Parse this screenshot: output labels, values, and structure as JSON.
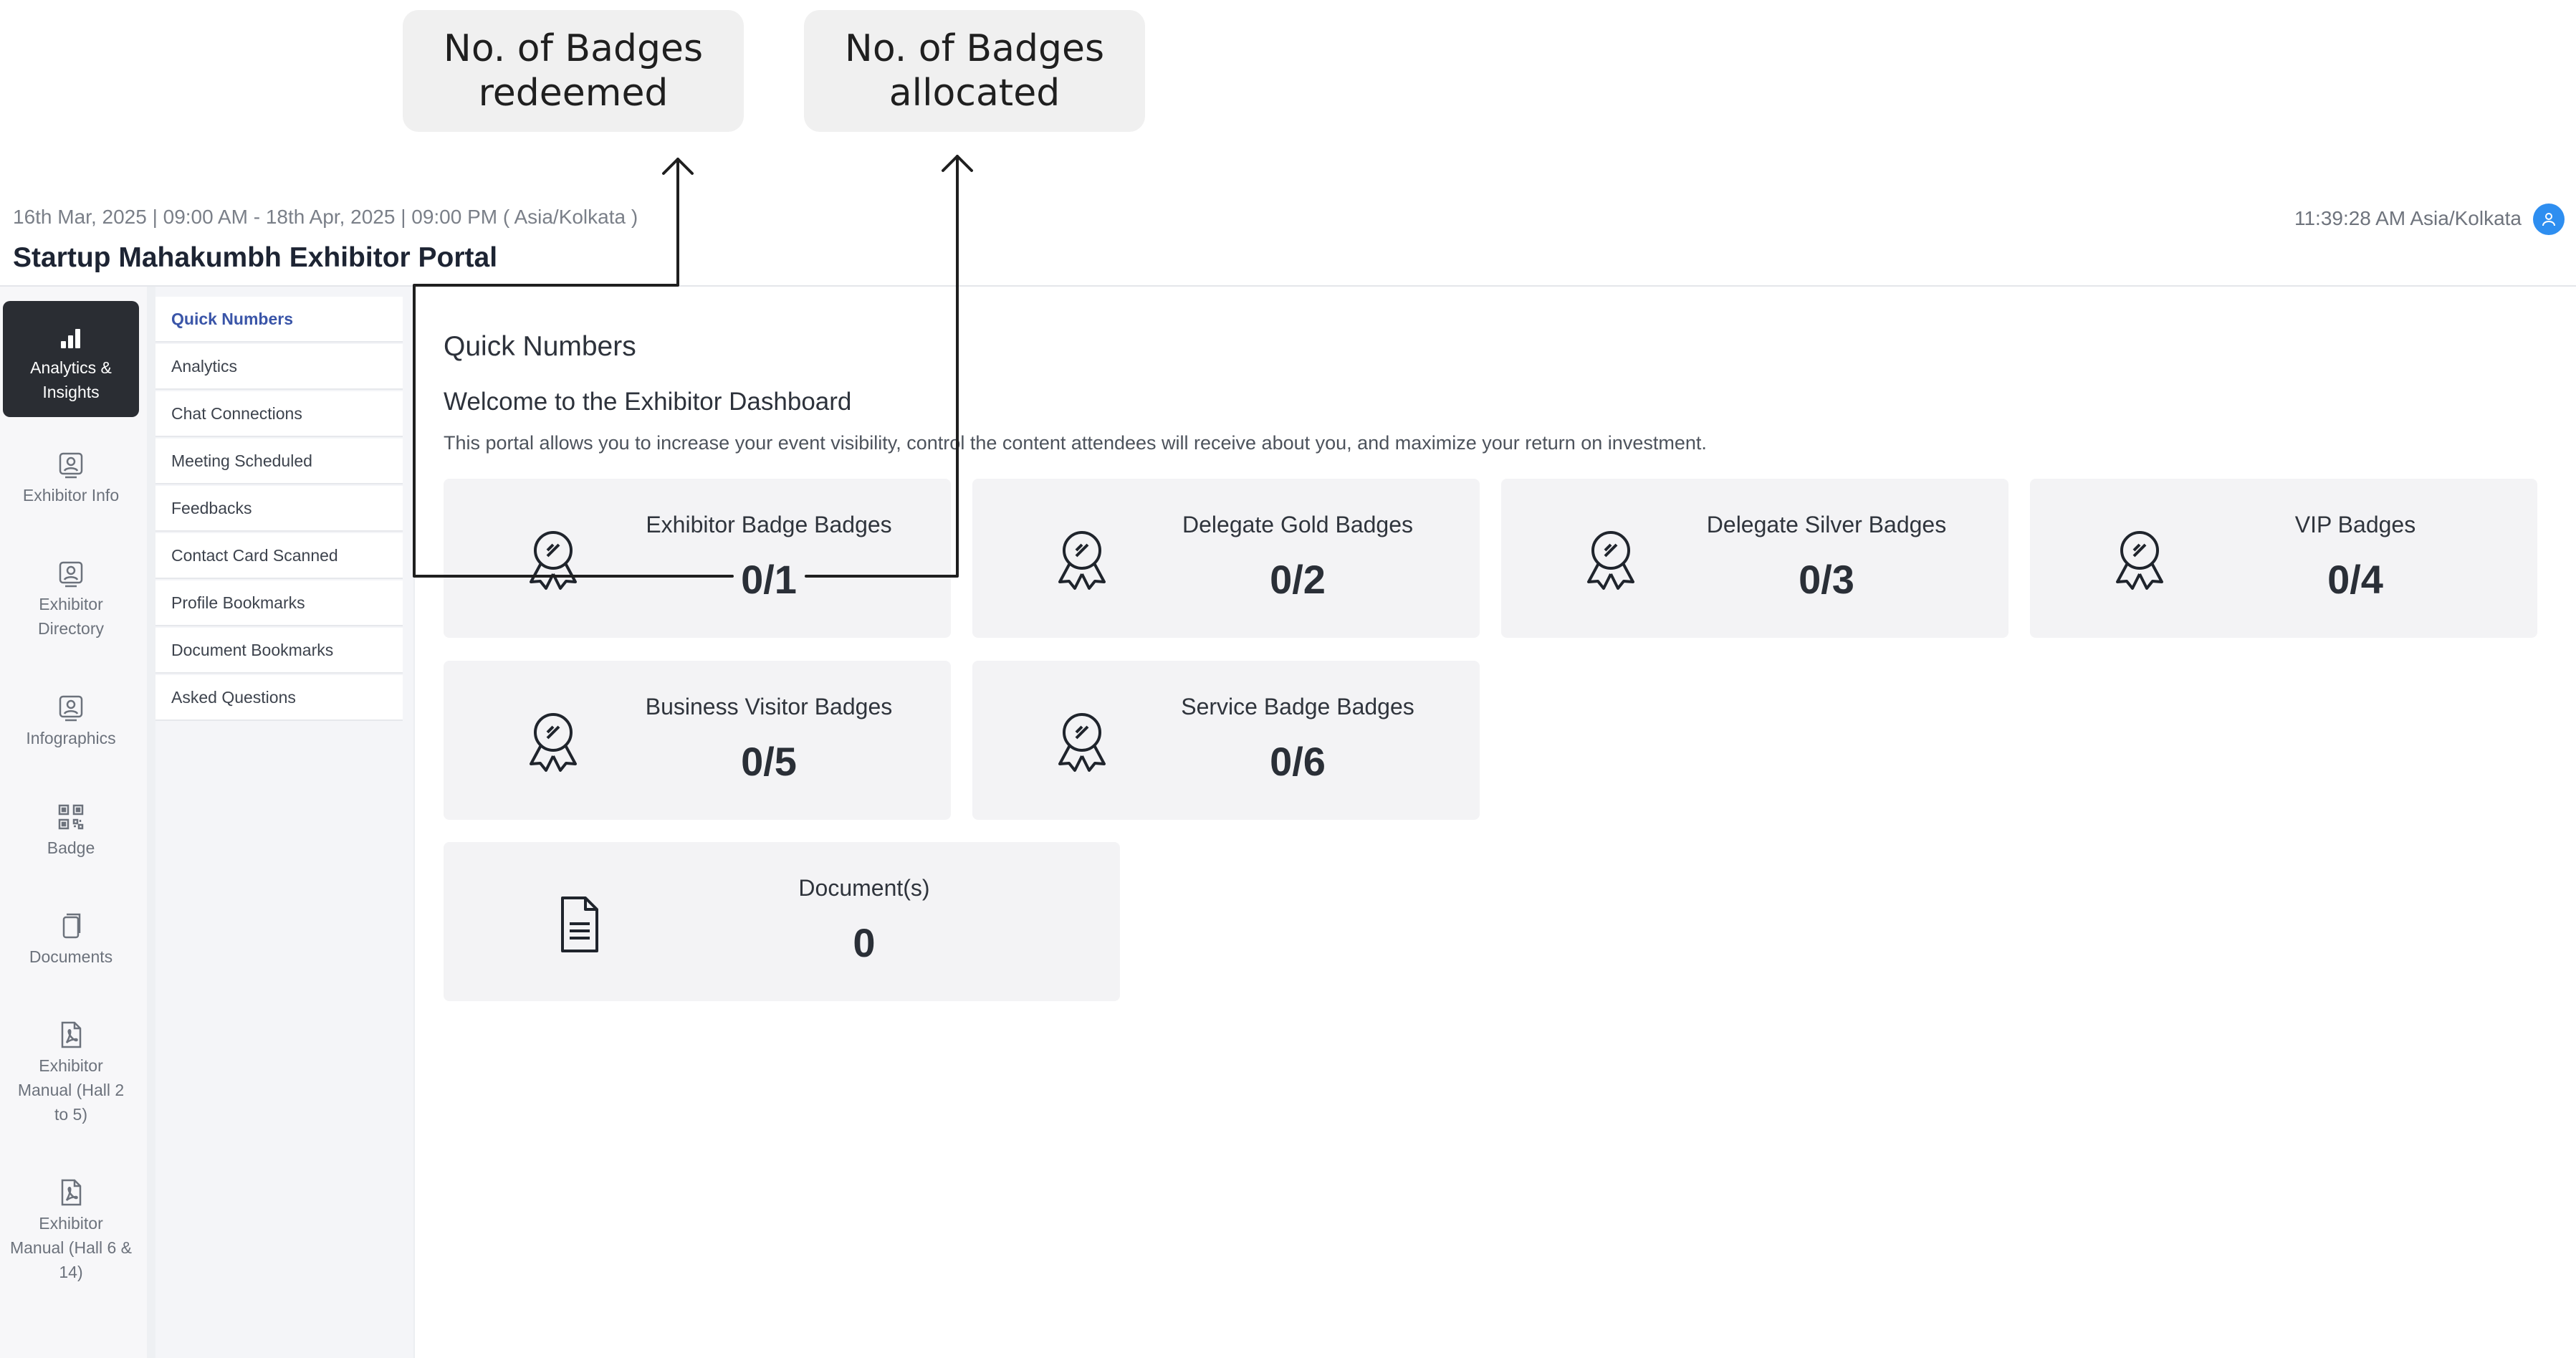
{
  "annotations": {
    "redeemed": "No. of Badges\nredeemed",
    "allocated": "No. of Badges\nallocated"
  },
  "header": {
    "date_range": "16th Mar, 2025 | 09:00 AM - 18th Apr, 2025 | 09:00 PM ( Asia/Kolkata )",
    "portal_title": "Startup Mahakumbh Exhibitor Portal",
    "clock": "11:39:28 AM Asia/Kolkata",
    "avatar_icon": "user-icon"
  },
  "rail": {
    "items": [
      {
        "label": "Analytics &\nInsights",
        "icon": "bar-chart-icon",
        "active": true
      },
      {
        "label": "Exhibitor Info",
        "icon": "id-card-icon"
      },
      {
        "label": "Exhibitor\nDirectory",
        "icon": "id-card-icon"
      },
      {
        "label": "Infographics",
        "icon": "id-card-icon"
      },
      {
        "label": "Badge",
        "icon": "qr-code-icon"
      },
      {
        "label": "Documents",
        "icon": "copy-icon"
      },
      {
        "label": "Exhibitor\nManual (Hall 2\nto 5)",
        "icon": "pdf-icon"
      },
      {
        "label": "Exhibitor\nManual (Hall 6 &\n14)",
        "icon": "pdf-icon"
      }
    ]
  },
  "submenu": {
    "items": [
      {
        "label": "Quick Numbers",
        "active": true
      },
      {
        "label": "Analytics"
      },
      {
        "label": "Chat Connections"
      },
      {
        "label": "Meeting Scheduled"
      },
      {
        "label": "Feedbacks"
      },
      {
        "label": "Contact Card Scanned"
      },
      {
        "label": "Profile Bookmarks"
      },
      {
        "label": "Document Bookmarks"
      },
      {
        "label": "Asked Questions"
      }
    ]
  },
  "main": {
    "section_title": "Quick Numbers",
    "welcome": "Welcome to the Exhibitor Dashboard",
    "description": "This portal allows you to increase your event visibility, control the content attendees will receive about you, and maximize your return on investment.",
    "cards": [
      {
        "label": "Exhibitor Badge Badges",
        "value": "0/1",
        "icon": "award-ribbon-icon"
      },
      {
        "label": "Delegate Gold Badges",
        "value": "0/2",
        "icon": "award-ribbon-icon"
      },
      {
        "label": "Delegate Silver Badges",
        "value": "0/3",
        "icon": "award-ribbon-icon"
      },
      {
        "label": "VIP Badges",
        "value": "0/4",
        "icon": "award-ribbon-icon"
      },
      {
        "label": "Business Visitor Badges",
        "value": "0/5",
        "icon": "award-ribbon-icon"
      },
      {
        "label": "Service Badge Badges",
        "value": "0/6",
        "icon": "award-ribbon-icon"
      },
      {
        "label": "Document(s)",
        "value": "0",
        "icon": "document-icon"
      }
    ]
  },
  "colors": {
    "accent_blue": "#2e8ef0",
    "active_rail": "#2a2d33",
    "active_submenu_text": "#3a55a8",
    "card_bg": "#f3f3f5"
  }
}
